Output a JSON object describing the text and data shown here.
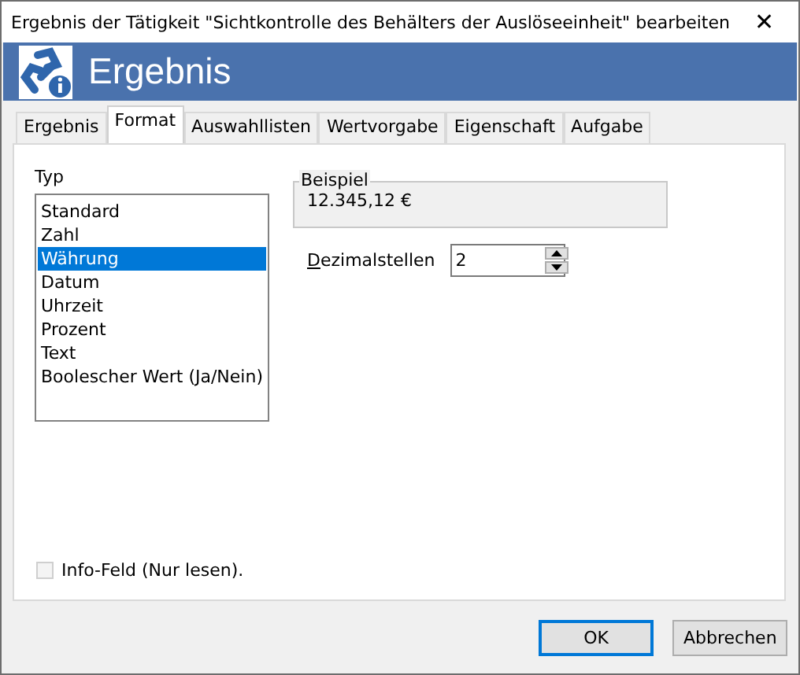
{
  "window": {
    "title": "Ergebnis der Tätigkeit \"Sichtkontrolle des Behälters der Auslöseeinheit\" bearbeiten",
    "close": "✕"
  },
  "header": {
    "title": "Ergebnis"
  },
  "tabs": [
    {
      "label": "Ergebnis",
      "selected": false
    },
    {
      "label": "Format",
      "selected": true
    },
    {
      "label": "Auswahllisten",
      "selected": false
    },
    {
      "label": "Wertvorgabe",
      "selected": false
    },
    {
      "label": "Eigenschaft",
      "selected": false
    },
    {
      "label": "Aufgabe",
      "selected": false
    }
  ],
  "type_list": {
    "label": "Typ",
    "items": [
      {
        "label": "Standard",
        "selected": false
      },
      {
        "label": "Zahl",
        "selected": false
      },
      {
        "label": "Währung",
        "selected": true
      },
      {
        "label": "Datum",
        "selected": false
      },
      {
        "label": "Uhrzeit",
        "selected": false
      },
      {
        "label": "Prozent",
        "selected": false
      },
      {
        "label": "Text",
        "selected": false
      },
      {
        "label": "Boolescher Wert (Ja/Nein)",
        "selected": false
      }
    ]
  },
  "example": {
    "label": "Beispiel",
    "value": "12.345,12 €"
  },
  "decimals": {
    "label": "Dezimalstellen",
    "value": "2"
  },
  "info_field": {
    "label": "Info-Feld (Nur lesen).",
    "checked": false,
    "disabled": true
  },
  "buttons": [
    {
      "label": "OK",
      "default": true
    },
    {
      "label": "Abbrechen",
      "default": false
    }
  ]
}
